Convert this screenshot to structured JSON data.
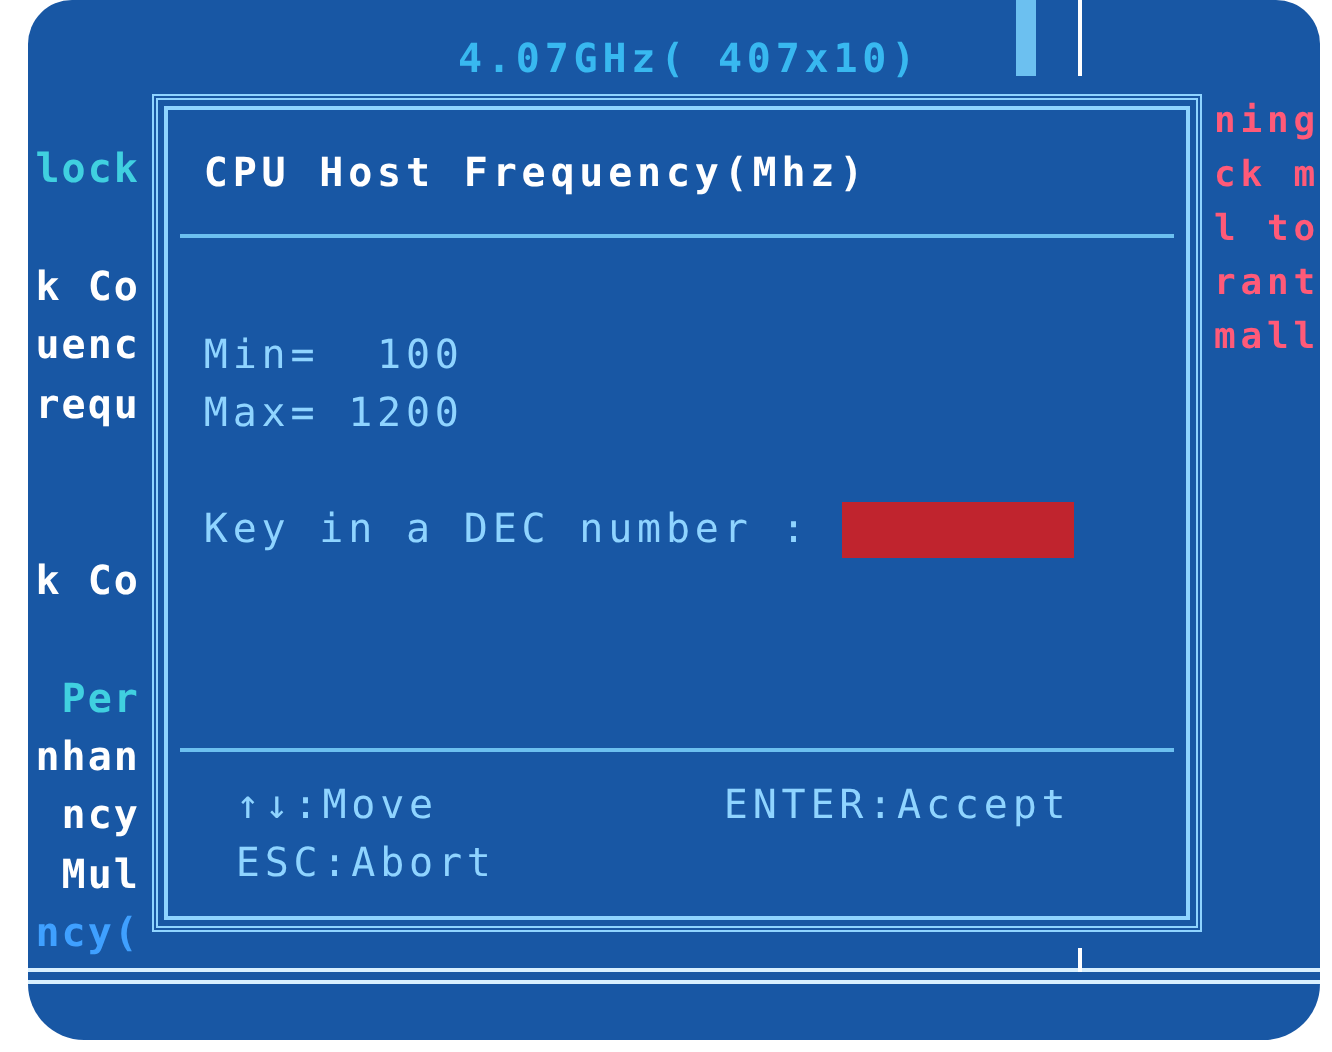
{
  "header": {
    "cpu_clock": "4.07GHz( 407x10)"
  },
  "left_column": [
    {
      "kind": "text",
      "text": "lock",
      "color": "#40d0e0"
    },
    {
      "kind": "spacer"
    },
    {
      "kind": "text",
      "text": "k Co",
      "color": "#ffffff"
    },
    {
      "kind": "text",
      "text": "uenc",
      "color": "#ffffff"
    },
    {
      "kind": "text",
      "text": "requ",
      "color": "#ffffff"
    },
    {
      "kind": "spacer"
    },
    {
      "kind": "spacer"
    },
    {
      "kind": "text",
      "text": "k Co",
      "color": "#ffffff"
    },
    {
      "kind": "spacer"
    },
    {
      "kind": "text",
      "text": "Per",
      "color": "#40d0e0"
    },
    {
      "kind": "text",
      "text": "nhan",
      "color": "#ffffff"
    },
    {
      "kind": "text",
      "text": "ncy",
      "color": "#ffffff"
    },
    {
      "kind": "text",
      "text": "Mul",
      "color": "#ffffff"
    },
    {
      "kind": "text",
      "text": "ncy(",
      "color": "#3fa0ff"
    }
  ],
  "right_column": [
    "ning",
    "ck m",
    "l to",
    "rant",
    "mall"
  ],
  "dialog": {
    "title": "CPU Host Frequency(Mhz)",
    "min": "Min=  100",
    "max": "Max= 1200",
    "prompt": "Key in a DEC number :",
    "keys": [
      "↑↓:Move",
      "ENTER:Accept",
      "ESC:Abort"
    ]
  }
}
